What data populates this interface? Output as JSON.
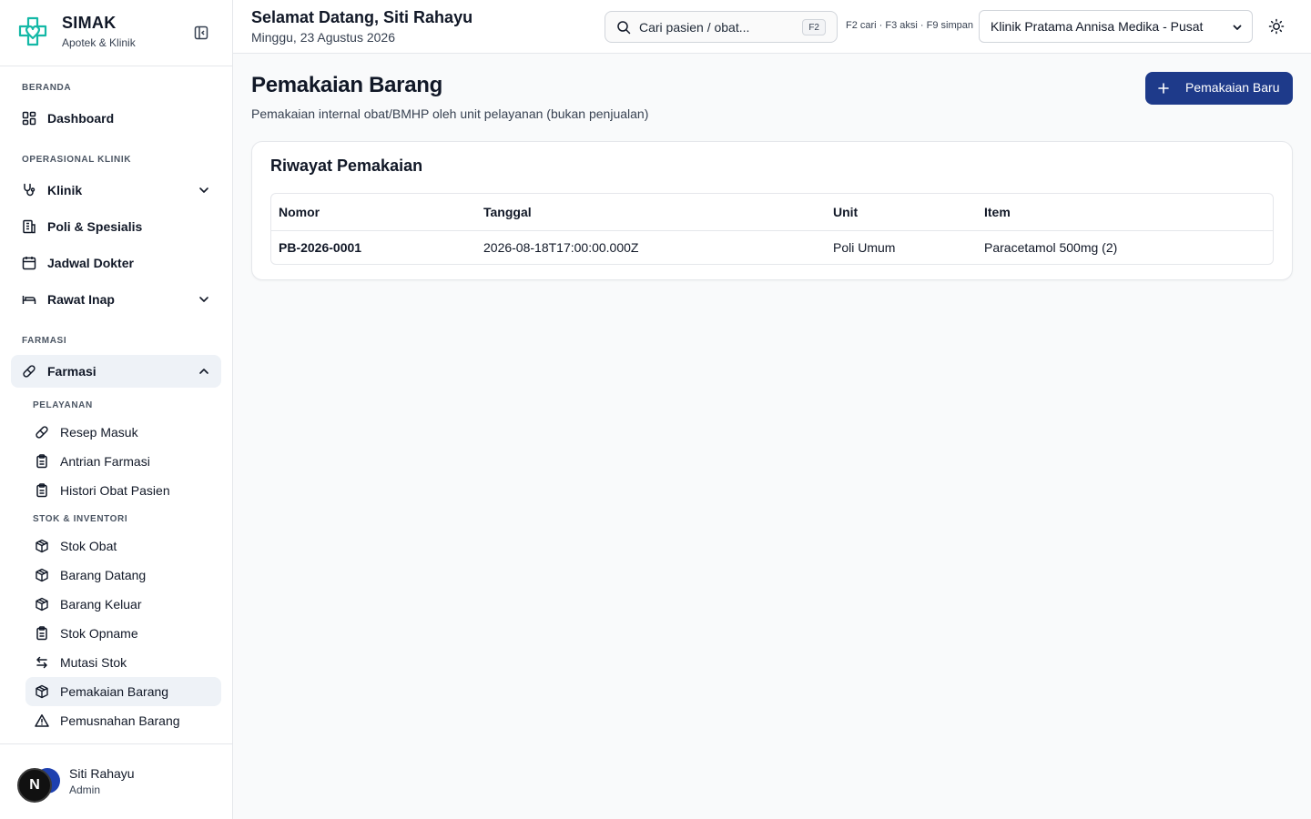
{
  "brand": {
    "name": "SIMAK",
    "subtitle": "Apotek & Klinik"
  },
  "sidebar": {
    "sections": {
      "beranda": "BERANDA",
      "operasional": "OPERASIONAL KLINIK",
      "farmasi": "FARMASI"
    },
    "items": {
      "dashboard": "Dashboard",
      "klinik": "Klinik",
      "poli": "Poli & Spesialis",
      "jadwal": "Jadwal Dokter",
      "rawat_inap": "Rawat Inap",
      "farmasi": "Farmasi"
    },
    "farmasi_sub": {
      "pelayanan_label": "PELAYANAN",
      "resep_masuk": "Resep Masuk",
      "antrian": "Antrian Farmasi",
      "histori": "Histori Obat Pasien",
      "stok_label": "STOK & INVENTORI",
      "stok_obat": "Stok Obat",
      "barang_datang": "Barang Datang",
      "barang_keluar": "Barang Keluar",
      "stok_opname": "Stok Opname",
      "mutasi": "Mutasi Stok",
      "pemakaian": "Pemakaian Barang",
      "pemusnahan": "Pemusnahan Barang"
    }
  },
  "user": {
    "initial": "N",
    "name": "Siti Rahayu",
    "role": "Admin"
  },
  "header": {
    "welcome": "Selamat Datang, Siti Rahayu",
    "date": "Minggu, 23 Agustus 2026",
    "search_placeholder": "Cari pasien / obat...",
    "search_kbd": "F2",
    "shortcuts": "F2 cari · F3 aksi · F9 simpan",
    "clinic": "Klinik Pratama Annisa Medika - Pusat"
  },
  "page": {
    "title": "Pemakaian Barang",
    "subtitle": "Pemakaian internal obat/BMHP oleh unit pelayanan (bukan penjualan)",
    "new_button": "Pemakaian Baru"
  },
  "card": {
    "title": "Riwayat Pemakaian",
    "columns": [
      "Nomor",
      "Tanggal",
      "Unit",
      "Item"
    ],
    "rows": [
      [
        "PB-2026-0001",
        "2026-08-18T17:00:00.000Z",
        "Poli Umum",
        "Paracetamol 500mg (2)"
      ]
    ]
  },
  "colors": {
    "primary": "#1e3a8a",
    "brand": "#14b8a6",
    "active_bg": "#eef2f7"
  }
}
